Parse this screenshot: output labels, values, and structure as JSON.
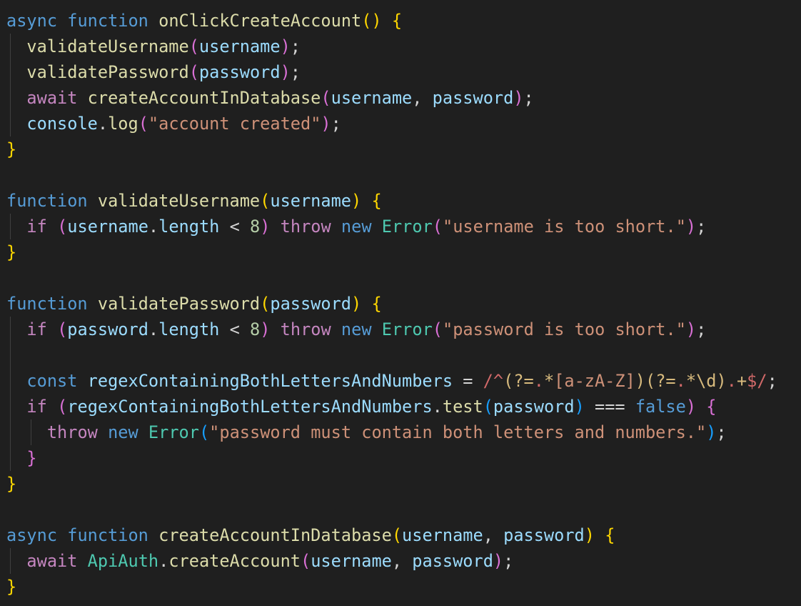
{
  "colors": {
    "background": "#1f1f1f",
    "indent_guide": "#404040",
    "plain": "#d4d4d4",
    "keyword": "#569cd6",
    "control": "#c586c0",
    "function": "#dcdcaa",
    "variable": "#9cdcfe",
    "class": "#4ec9b0",
    "string": "#ce9178",
    "number": "#b5cea8",
    "regex": "#d16969",
    "regex_escape": "#d7ba7d",
    "regex_class": "#ce9178",
    "bracket1": "#ffd700",
    "bracket2": "#da70d6",
    "bracket3": "#179fff"
  },
  "code": {
    "lines": [
      [
        [
          "async",
          "keyword"
        ],
        [
          " ",
          "plain"
        ],
        [
          "function",
          "keyword"
        ],
        [
          " ",
          "plain"
        ],
        [
          "onClickCreateAccount",
          "function"
        ],
        [
          "()",
          "bracket1"
        ],
        [
          " ",
          "plain"
        ],
        [
          "{",
          "bracket1"
        ]
      ],
      [
        [
          "  ",
          "plain"
        ],
        [
          "validateUsername",
          "function"
        ],
        [
          "(",
          "bracket2"
        ],
        [
          "username",
          "variable"
        ],
        [
          ")",
          "bracket2"
        ],
        [
          ";",
          "plain"
        ]
      ],
      [
        [
          "  ",
          "plain"
        ],
        [
          "validatePassword",
          "function"
        ],
        [
          "(",
          "bracket2"
        ],
        [
          "password",
          "variable"
        ],
        [
          ")",
          "bracket2"
        ],
        [
          ";",
          "plain"
        ]
      ],
      [
        [
          "  ",
          "plain"
        ],
        [
          "await",
          "control"
        ],
        [
          " ",
          "plain"
        ],
        [
          "createAccountInDatabase",
          "function"
        ],
        [
          "(",
          "bracket2"
        ],
        [
          "username",
          "variable"
        ],
        [
          ", ",
          "plain"
        ],
        [
          "password",
          "variable"
        ],
        [
          ")",
          "bracket2"
        ],
        [
          ";",
          "plain"
        ]
      ],
      [
        [
          "  ",
          "plain"
        ],
        [
          "console",
          "variable"
        ],
        [
          ".",
          "plain"
        ],
        [
          "log",
          "function"
        ],
        [
          "(",
          "bracket2"
        ],
        [
          "\"account created\"",
          "string"
        ],
        [
          ")",
          "bracket2"
        ],
        [
          ";",
          "plain"
        ]
      ],
      [
        [
          "}",
          "bracket1"
        ]
      ],
      [],
      [
        [
          "function",
          "keyword"
        ],
        [
          " ",
          "plain"
        ],
        [
          "validateUsername",
          "function"
        ],
        [
          "(",
          "bracket1"
        ],
        [
          "username",
          "variable"
        ],
        [
          ")",
          "bracket1"
        ],
        [
          " ",
          "plain"
        ],
        [
          "{",
          "bracket1"
        ]
      ],
      [
        [
          "  ",
          "plain"
        ],
        [
          "if",
          "control"
        ],
        [
          " ",
          "plain"
        ],
        [
          "(",
          "bracket2"
        ],
        [
          "username",
          "variable"
        ],
        [
          ".",
          "plain"
        ],
        [
          "length",
          "variable"
        ],
        [
          " < ",
          "plain"
        ],
        [
          "8",
          "number"
        ],
        [
          ")",
          "bracket2"
        ],
        [
          " ",
          "plain"
        ],
        [
          "throw",
          "control"
        ],
        [
          " ",
          "plain"
        ],
        [
          "new",
          "keyword"
        ],
        [
          " ",
          "plain"
        ],
        [
          "Error",
          "class"
        ],
        [
          "(",
          "bracket2"
        ],
        [
          "\"username is too short.\"",
          "string"
        ],
        [
          ")",
          "bracket2"
        ],
        [
          ";",
          "plain"
        ]
      ],
      [
        [
          "}",
          "bracket1"
        ]
      ],
      [],
      [
        [
          "function",
          "keyword"
        ],
        [
          " ",
          "plain"
        ],
        [
          "validatePassword",
          "function"
        ],
        [
          "(",
          "bracket1"
        ],
        [
          "password",
          "variable"
        ],
        [
          ")",
          "bracket1"
        ],
        [
          " ",
          "plain"
        ],
        [
          "{",
          "bracket1"
        ]
      ],
      [
        [
          "  ",
          "plain"
        ],
        [
          "if",
          "control"
        ],
        [
          " ",
          "plain"
        ],
        [
          "(",
          "bracket2"
        ],
        [
          "password",
          "variable"
        ],
        [
          ".",
          "plain"
        ],
        [
          "length",
          "variable"
        ],
        [
          " < ",
          "plain"
        ],
        [
          "8",
          "number"
        ],
        [
          ")",
          "bracket2"
        ],
        [
          " ",
          "plain"
        ],
        [
          "throw",
          "control"
        ],
        [
          " ",
          "plain"
        ],
        [
          "new",
          "keyword"
        ],
        [
          " ",
          "plain"
        ],
        [
          "Error",
          "class"
        ],
        [
          "(",
          "bracket2"
        ],
        [
          "\"password is too short.\"",
          "string"
        ],
        [
          ")",
          "bracket2"
        ],
        [
          ";",
          "plain"
        ]
      ],
      [],
      [
        [
          "  ",
          "plain"
        ],
        [
          "const",
          "keyword"
        ],
        [
          " ",
          "plain"
        ],
        [
          "regexContainingBothLettersAndNumbers",
          "variable"
        ],
        [
          " = ",
          "plain"
        ],
        [
          "/^",
          "regex"
        ],
        [
          "(?=",
          "regex_escape"
        ],
        [
          ".",
          "regex"
        ],
        [
          "*",
          "regex_escape"
        ],
        [
          "[a-zA-Z]",
          "regex_class"
        ],
        [
          ")",
          "regex_escape"
        ],
        [
          "(?=",
          "regex_escape"
        ],
        [
          ".",
          "regex"
        ],
        [
          "*",
          "regex_escape"
        ],
        [
          "\\d",
          "regex_escape"
        ],
        [
          ")",
          "regex_escape"
        ],
        [
          ".",
          "regex"
        ],
        [
          "+",
          "regex_escape"
        ],
        [
          "$",
          "regex"
        ],
        [
          "/",
          "regex"
        ],
        [
          ";",
          "plain"
        ]
      ],
      [
        [
          "  ",
          "plain"
        ],
        [
          "if",
          "control"
        ],
        [
          " ",
          "plain"
        ],
        [
          "(",
          "bracket2"
        ],
        [
          "regexContainingBothLettersAndNumbers",
          "variable"
        ],
        [
          ".",
          "plain"
        ],
        [
          "test",
          "function"
        ],
        [
          "(",
          "bracket3"
        ],
        [
          "password",
          "variable"
        ],
        [
          ")",
          "bracket3"
        ],
        [
          " === ",
          "plain"
        ],
        [
          "false",
          "keyword"
        ],
        [
          ")",
          "bracket2"
        ],
        [
          " ",
          "plain"
        ],
        [
          "{",
          "bracket2"
        ]
      ],
      [
        [
          "    ",
          "plain"
        ],
        [
          "throw",
          "control"
        ],
        [
          " ",
          "plain"
        ],
        [
          "new",
          "keyword"
        ],
        [
          " ",
          "plain"
        ],
        [
          "Error",
          "class"
        ],
        [
          "(",
          "bracket3"
        ],
        [
          "\"password must contain both letters and numbers.\"",
          "string"
        ],
        [
          ")",
          "bracket3"
        ],
        [
          ";",
          "plain"
        ]
      ],
      [
        [
          "  ",
          "plain"
        ],
        [
          "}",
          "bracket2"
        ]
      ],
      [
        [
          "}",
          "bracket1"
        ]
      ],
      [],
      [
        [
          "async",
          "keyword"
        ],
        [
          " ",
          "plain"
        ],
        [
          "function",
          "keyword"
        ],
        [
          " ",
          "plain"
        ],
        [
          "createAccountInDatabase",
          "function"
        ],
        [
          "(",
          "bracket1"
        ],
        [
          "username",
          "variable"
        ],
        [
          ", ",
          "plain"
        ],
        [
          "password",
          "variable"
        ],
        [
          ")",
          "bracket1"
        ],
        [
          " ",
          "plain"
        ],
        [
          "{",
          "bracket1"
        ]
      ],
      [
        [
          "  ",
          "plain"
        ],
        [
          "await",
          "control"
        ],
        [
          " ",
          "plain"
        ],
        [
          "ApiAuth",
          "class"
        ],
        [
          ".",
          "plain"
        ],
        [
          "createAccount",
          "function"
        ],
        [
          "(",
          "bracket2"
        ],
        [
          "username",
          "variable"
        ],
        [
          ", ",
          "plain"
        ],
        [
          "password",
          "variable"
        ],
        [
          ")",
          "bracket2"
        ],
        [
          ";",
          "plain"
        ]
      ],
      [
        [
          "}",
          "bracket1"
        ]
      ]
    ]
  }
}
